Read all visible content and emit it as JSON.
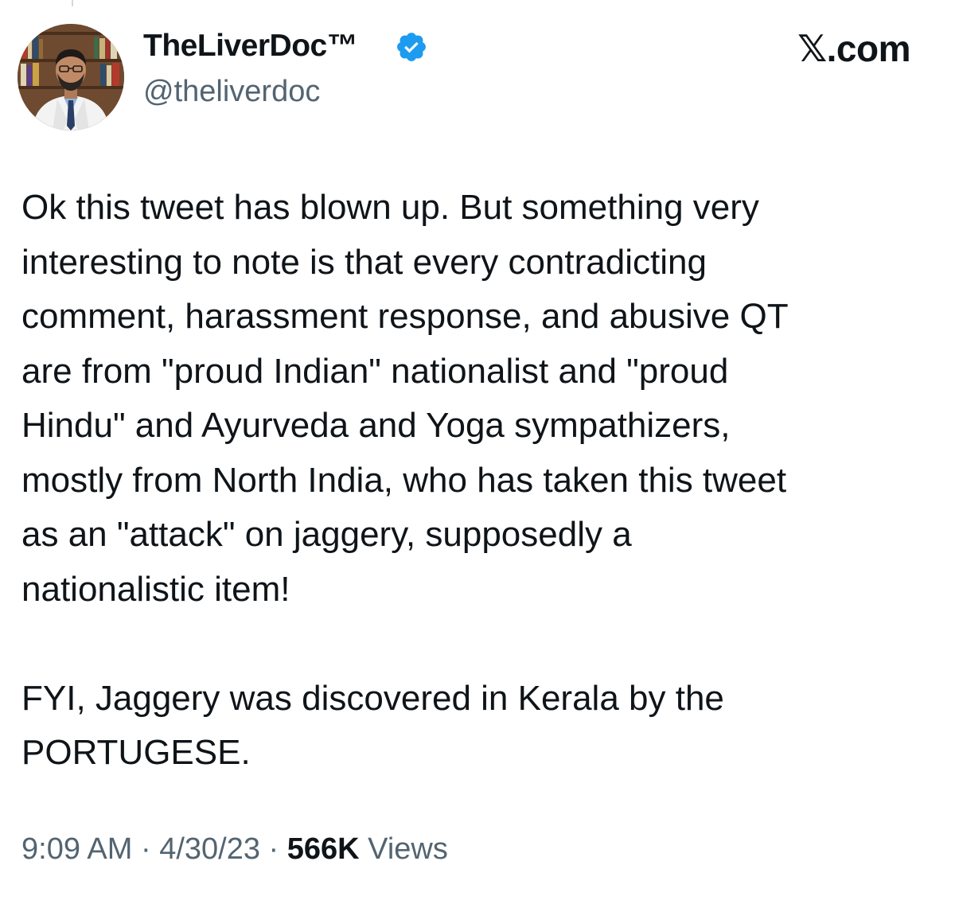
{
  "author": {
    "display_name": "TheLiverDoc™",
    "handle": "@theliverdoc",
    "verified_color": "#1d9bf0",
    "avatar_icon": "profile-photo"
  },
  "brand": {
    "label": "𝕏.com"
  },
  "tweet": {
    "paragraph_1": "Ok this tweet has blown up. But something very\ninteresting to note is that every contradicting\ncomment, harassment response, and abusive QT\nare from \"proud Indian\" nationalist and \"proud\nHindu\" and Ayurveda and Yoga sympathizers,\nmostly from North India, who has taken this tweet\nas an \"attack\" on jaggery, supposedly a\nnationalistic item!",
    "paragraph_2": "FYI, Jaggery was discovered in Kerala by the\nPORTUGESE."
  },
  "meta": {
    "time": "9:09 AM",
    "separator": " · ",
    "date": "4/30/23",
    "views_count": "566K",
    "views_label": " Views"
  },
  "colors": {
    "text_primary": "#0f1419",
    "text_secondary": "#536471",
    "accent": "#1d9bf0"
  }
}
